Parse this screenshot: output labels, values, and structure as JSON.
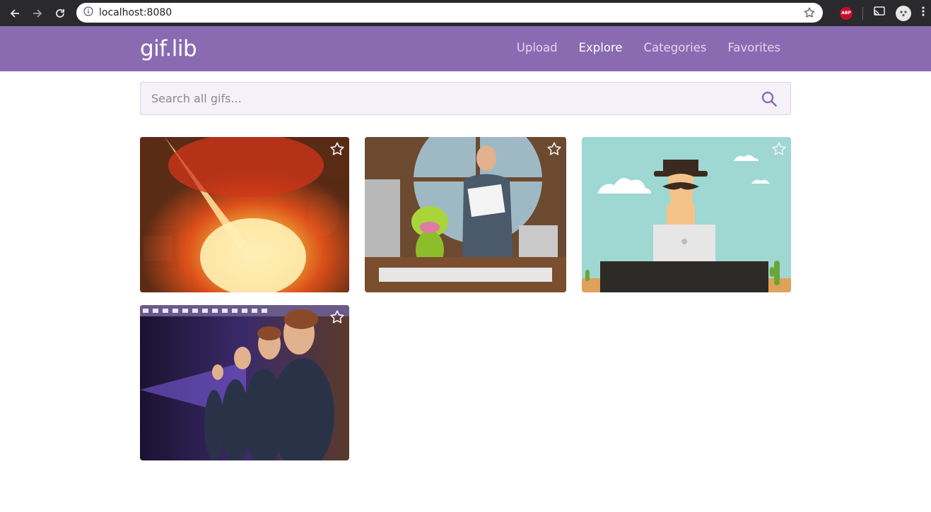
{
  "browser": {
    "url": "localhost:8080",
    "abp_label": "ABP"
  },
  "header": {
    "logo": "gif.lib",
    "nav": [
      {
        "label": "Upload",
        "active": false
      },
      {
        "label": "Explore",
        "active": true
      },
      {
        "label": "Categories",
        "active": false
      },
      {
        "label": "Favorites",
        "active": false
      }
    ]
  },
  "search": {
    "placeholder": "Search all gifs...",
    "value": ""
  },
  "gifs": [
    {
      "subject": "explosion",
      "favorited": false
    },
    {
      "subject": "frog-and-presenter",
      "favorited": false
    },
    {
      "subject": "cowboy-laptop",
      "favorited": false
    },
    {
      "subject": "infinite-mirror",
      "favorited": false
    }
  ],
  "colors": {
    "brand": "#8a6bb1",
    "nav_active": "#ffffff",
    "nav_inactive": "#e0d6ee",
    "search_bg": "#f4f1f8",
    "search_icon": "#8a6bb1"
  }
}
